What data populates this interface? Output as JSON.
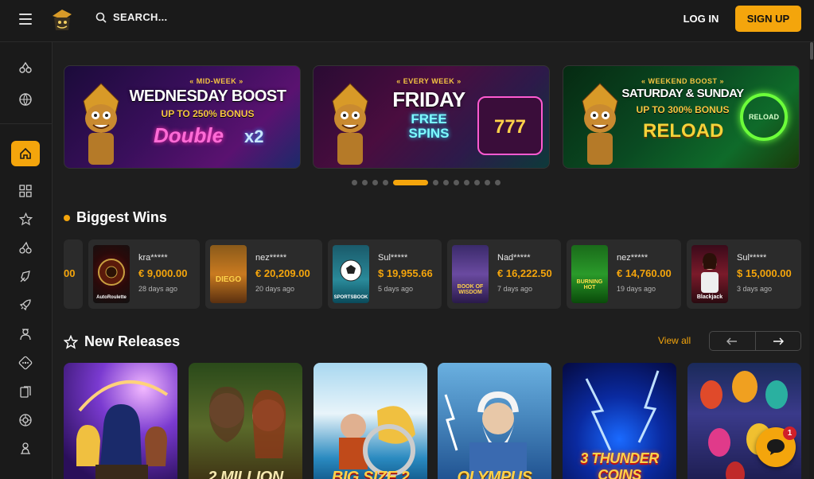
{
  "header": {
    "search_label": "SEARCH...",
    "login_label": "LOG IN",
    "signup_label": "SIGN UP"
  },
  "colors": {
    "accent": "#f4a50c",
    "background": "#1e1e1e",
    "card": "#2b2b2b"
  },
  "sidebar": {
    "items": [
      {
        "icon": "slots-icon"
      },
      {
        "icon": "sports-ball-icon"
      },
      {
        "icon": "home-icon",
        "active": true
      },
      {
        "icon": "grid-icon"
      },
      {
        "icon": "star-icon"
      },
      {
        "icon": "cherries-icon"
      },
      {
        "icon": "crash-rocket-icon"
      },
      {
        "icon": "rocket-icon"
      },
      {
        "icon": "dealer-icon"
      },
      {
        "icon": "dice-icon"
      },
      {
        "icon": "cards-icon"
      },
      {
        "icon": "roulette-icon"
      },
      {
        "icon": "person-icon"
      }
    ]
  },
  "banners": [
    {
      "overline": "« MID-WEEK »",
      "title": "WEDNESDAY BOOST",
      "sub": "UP TO 250% BONUS",
      "big": "Double",
      "badge": "x2"
    },
    {
      "overline": "« EVERY WEEK »",
      "title": "FRIDAY",
      "sub": "",
      "big": "FREE SPINS",
      "badge": "777"
    },
    {
      "overline": "« WEEKEND BOOST »",
      "title": "SATURDAY & SUNDAY",
      "sub": "UP TO 300% BONUS",
      "big": "RELOAD",
      "badge": "RELOAD"
    }
  ],
  "carousel": {
    "dots": 12,
    "active_index": 4
  },
  "biggest_wins": {
    "title": "Biggest Wins",
    "partial_amount": "00",
    "items": [
      {
        "user": "kra*****",
        "amount": "€ 9,000.00",
        "time": "28 days ago",
        "game": "Roulette",
        "thumb_label": "AutoRoulette"
      },
      {
        "user": "nez*****",
        "amount": "€ 20,209.00",
        "time": "20 days ago",
        "game": "Diego Fortune",
        "thumb_label": "DIEGO"
      },
      {
        "user": "Sul*****",
        "amount": "$ 19,955.66",
        "time": "5 days ago",
        "game": "Sportsbook",
        "thumb_label": "SPORTSBOOK"
      },
      {
        "user": "Nad*****",
        "amount": "€ 16,222.50",
        "time": "7 days ago",
        "game": "Book of Wisdom",
        "thumb_label": "BOOK OF WISDOM"
      },
      {
        "user": "nez*****",
        "amount": "€ 14,760.00",
        "time": "19 days ago",
        "game": "Burning Hot",
        "thumb_label": "BURNING HOT"
      },
      {
        "user": "Sul*****",
        "amount": "$ 15,000.00",
        "time": "3 days ago",
        "game": "Blackjack",
        "thumb_label": "Blackjack"
      }
    ]
  },
  "new_releases": {
    "title": "New Releases",
    "view_all": "View all",
    "games": [
      {
        "name": ""
      },
      {
        "name": "2 MILLION"
      },
      {
        "name": "BIG SIZE 2"
      },
      {
        "name": "OLYMPUS"
      },
      {
        "name": "3 THUNDER COINS"
      },
      {
        "name": ""
      }
    ]
  },
  "chat": {
    "badge": "1"
  }
}
